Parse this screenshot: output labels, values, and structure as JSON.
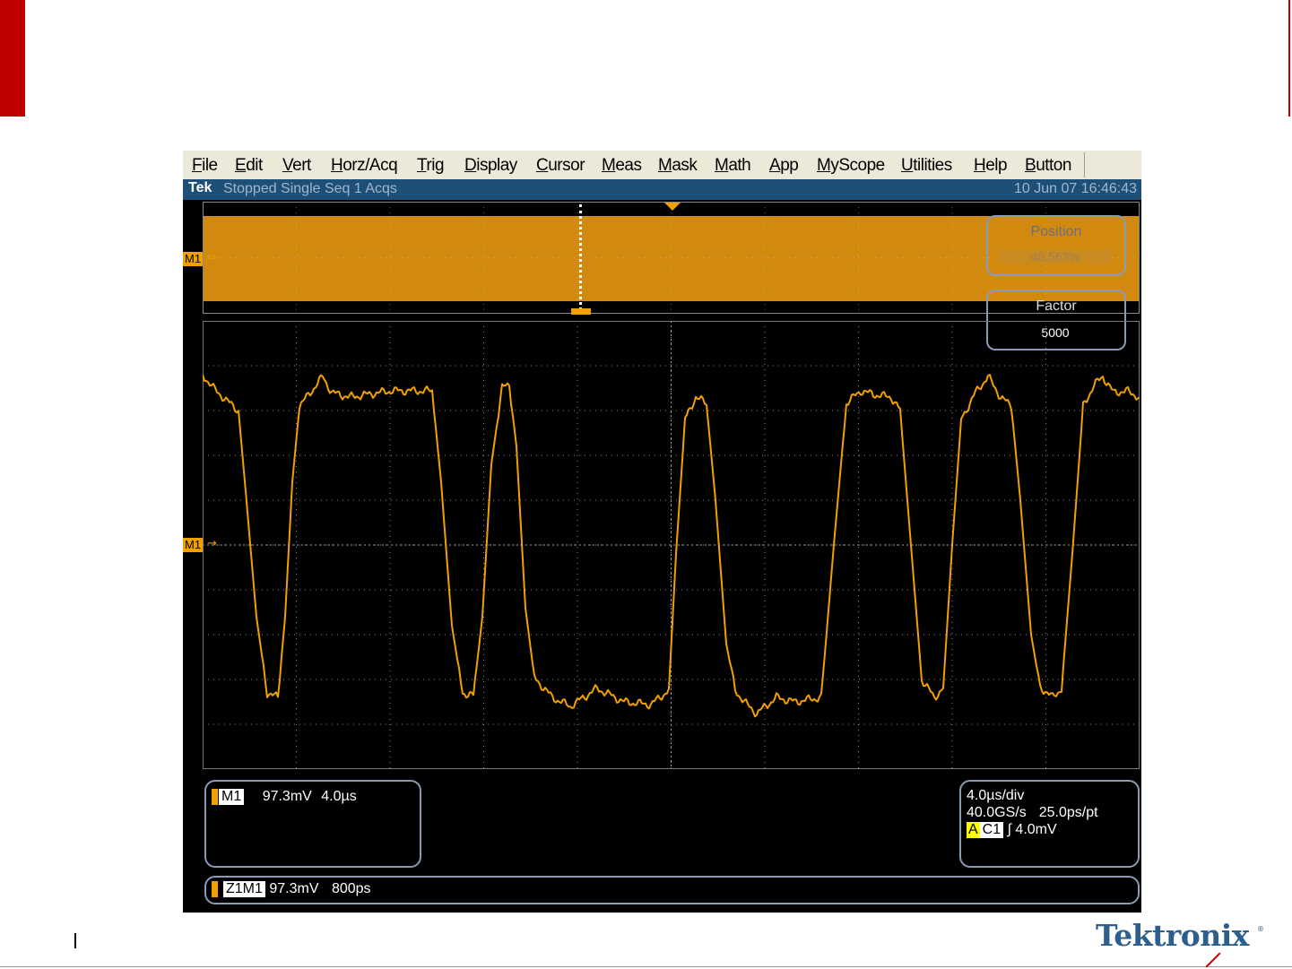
{
  "menu": {
    "items": [
      "File",
      "Edit",
      "Vert",
      "Horz/Acq",
      "Trig",
      "Display",
      "Cursor",
      "Meas",
      "Mask",
      "Math",
      "App",
      "MyScope",
      "Utilities",
      "Help",
      "Button"
    ]
  },
  "status": {
    "brand": "Tek",
    "state": "Stopped Single Seq 1 Acqs",
    "datetime": "10 Jun 07 16:46:43"
  },
  "channel_labels": {
    "overview": "M1",
    "overview_arrow": "⇨",
    "main": "M1",
    "main_arrow": "→"
  },
  "zoom_controls": {
    "position_title": "Position",
    "position_value": "40.563%",
    "factor_title": "Factor",
    "factor_value": "5000"
  },
  "readouts": {
    "channel": {
      "tag": "M1",
      "scale": "97.3mV",
      "time": "4.0µs"
    },
    "zoom": {
      "tag": "Z1M1",
      "scale": "97.3mV",
      "time": "800ps"
    },
    "acquisition": {
      "timebase": "4.0µs/div",
      "sample_rate": "40.0GS/s",
      "resolution": "25.0ps/pt",
      "trigger_source_a": "A",
      "trigger_source": "C1",
      "trigger_slope": "∫",
      "trigger_level": "4.0mV"
    }
  },
  "footer": {
    "logo": "Tektronix",
    "logo_reg": "®"
  },
  "colors": {
    "trace": "#f0a000",
    "overview_fill": "#d28a0e",
    "statusbar": "#1e5077",
    "menubar": "#ece9d8",
    "box_border": "#8a9bb8",
    "accent_red": "#c00000"
  }
}
